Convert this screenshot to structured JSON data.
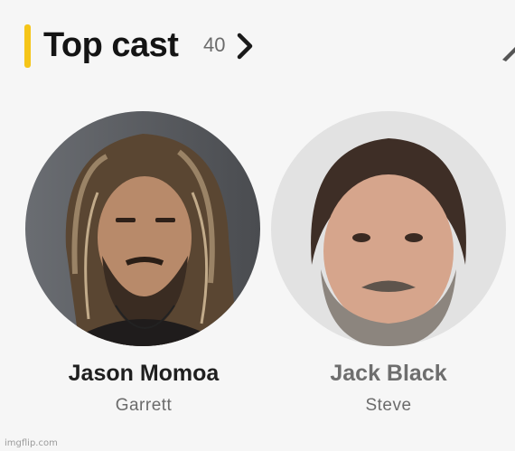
{
  "section": {
    "title": "Top cast",
    "count": "40",
    "accent_color": "#f5c518"
  },
  "cast": [
    {
      "actor": "Jason Momoa",
      "role": "Garrett"
    },
    {
      "actor": "Jack Black",
      "role": "Steve"
    }
  ],
  "watermark": "imgflip.com"
}
